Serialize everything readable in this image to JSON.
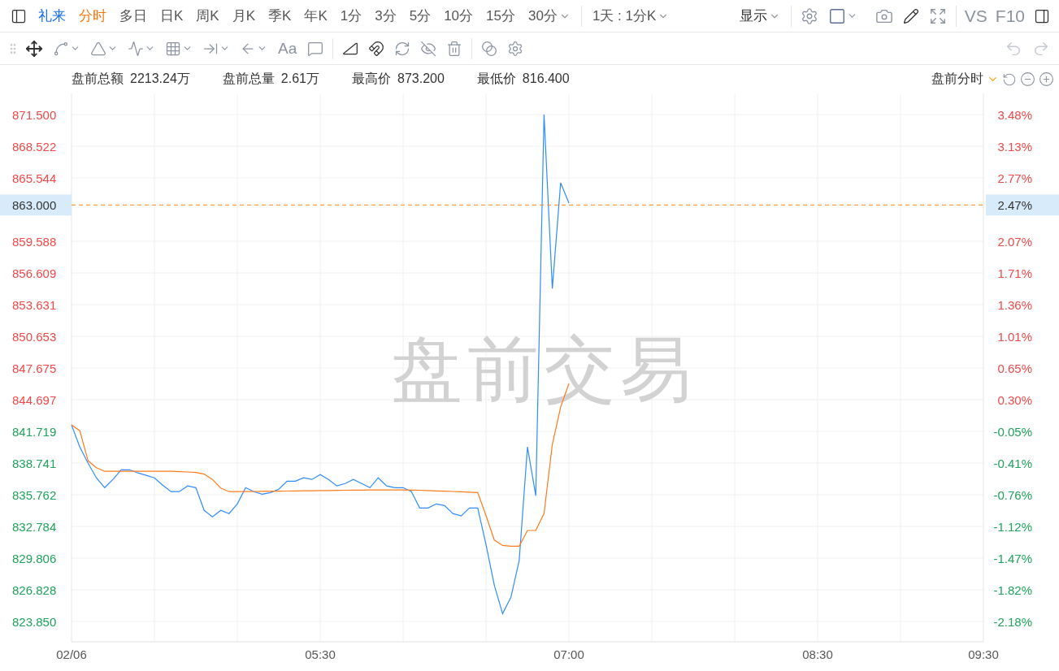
{
  "toolbar": {
    "symbol": "礼来",
    "periods": [
      {
        "label": "分时",
        "selected": true,
        "has_menu": false
      },
      {
        "label": "多日",
        "selected": false,
        "has_menu": false
      },
      {
        "label": "日K",
        "selected": false,
        "has_menu": false
      },
      {
        "label": "周K",
        "selected": false,
        "has_menu": false
      },
      {
        "label": "月K",
        "selected": false,
        "has_menu": false
      },
      {
        "label": "季K",
        "selected": false,
        "has_menu": false
      },
      {
        "label": "年K",
        "selected": false,
        "has_menu": false
      },
      {
        "label": "1分",
        "selected": false,
        "has_menu": false
      },
      {
        "label": "3分",
        "selected": false,
        "has_menu": false
      },
      {
        "label": "5分",
        "selected": false,
        "has_menu": false
      },
      {
        "label": "10分",
        "selected": false,
        "has_menu": false
      },
      {
        "label": "15分",
        "selected": false,
        "has_menu": false
      },
      {
        "label": "30分",
        "selected": false,
        "has_menu": true
      }
    ],
    "range": "1天 : 1分K",
    "display": "显示",
    "vs": "VS",
    "f10": "F10"
  },
  "drawing_toolbar": {
    "text_tool": "Aa"
  },
  "stats": [
    {
      "label": "盘前总额",
      "value": "2213.24万"
    },
    {
      "label": "盘前总量",
      "value": "2.61万"
    },
    {
      "label": "最高价",
      "value": "873.200"
    },
    {
      "label": "最低价",
      "value": "816.400"
    }
  ],
  "session_selector": "盘前分时",
  "chart": {
    "watermark": "盘前交易",
    "current_percent": "2.47%",
    "percent_axis": [
      {
        "label": "3.48%",
        "color": "#f04848"
      },
      {
        "label": "3.13%",
        "color": "#f04848"
      },
      {
        "label": "2.77%",
        "color": "#f04848"
      },
      {
        "label": "2.07%",
        "color": "#f04848"
      },
      {
        "label": "1.71%",
        "color": "#f04848"
      },
      {
        "label": "1.36%",
        "color": "#f04848"
      },
      {
        "label": "1.01%",
        "color": "#f04848"
      },
      {
        "label": "0.65%",
        "color": "#f04848"
      },
      {
        "label": "0.30%",
        "color": "#f04848"
      },
      {
        "label": "-0.05%",
        "color": "#1ea35b"
      },
      {
        "label": "-0.41%",
        "color": "#1ea35b"
      },
      {
        "label": "-0.76%",
        "color": "#1ea35b"
      },
      {
        "label": "-1.12%",
        "color": "#1ea35b"
      },
      {
        "label": "-1.47%",
        "color": "#1ea35b"
      },
      {
        "label": "-1.82%",
        "color": "#1ea35b"
      },
      {
        "label": "-2.18%",
        "color": "#1ea35b"
      }
    ],
    "chart_data": {
      "type": "line",
      "categories": [
        "02/06",
        null,
        null,
        null,
        null,
        null,
        null,
        null,
        null,
        null,
        null,
        null,
        null,
        null,
        null,
        null,
        null,
        null,
        null,
        null,
        null,
        null,
        null,
        null,
        null,
        null,
        null,
        null,
        null,
        null,
        "05:30",
        null,
        null,
        null,
        null,
        null,
        null,
        null,
        null,
        null,
        null,
        null,
        null,
        null,
        null,
        null,
        null,
        null,
        null,
        null,
        null,
        null,
        null,
        null,
        null,
        null,
        null,
        null,
        null,
        null,
        "07:00",
        null,
        null,
        null,
        null,
        null,
        null,
        null,
        null,
        null,
        null,
        null,
        null,
        null,
        null,
        null,
        null,
        null,
        null,
        null,
        null,
        null,
        null,
        null,
        null,
        null,
        null,
        null,
        null,
        null,
        "08:30",
        null,
        null,
        null,
        null,
        null,
        null,
        null,
        null,
        null,
        null,
        null,
        null,
        null,
        null,
        null,
        null,
        null,
        null,
        null,
        "09:30"
      ],
      "series": [
        {
          "color": "#2f8cff",
          "values": [
            842.32,
            840.25,
            838.72,
            837.35,
            836.43,
            837.2,
            838.11,
            838.11,
            837.81,
            837.58,
            837.35,
            836.66,
            836.05,
            836.05,
            836.59,
            836.43,
            834.29,
            833.68,
            834.29,
            833.99,
            834.9,
            836.43,
            836.05,
            835.82,
            835.97,
            836.28,
            837.04,
            837.04,
            837.35,
            837.2,
            837.65,
            837.2,
            836.59,
            836.81,
            837.2,
            836.81,
            836.43,
            837.35,
            836.59,
            836.43,
            836.43,
            836.05,
            834.52,
            834.52,
            834.9,
            834.75,
            833.99,
            833.76,
            834.52,
            834.52,
            831.08,
            827.26,
            824.59,
            826.12,
            829.56,
            840.25,
            835.67,
            871.5,
            855.15,
            865.08,
            863.17,
            null,
            null,
            null,
            null,
            null,
            null,
            null,
            null,
            null,
            null,
            null,
            null,
            null,
            null,
            null,
            null,
            null,
            null,
            null,
            null,
            null,
            null,
            null,
            null,
            null,
            null,
            null,
            null,
            null,
            null,
            null,
            null,
            null,
            null,
            null,
            null,
            null,
            null,
            null,
            null,
            null,
            null,
            null,
            null,
            null,
            null,
            null,
            null,
            null,
            null
          ]
        },
        {
          "color": "#ff7a1a",
          "values": [
            842.32,
            841.78,
            838.95,
            838.3,
            837.96,
            837.96,
            837.96,
            837.96,
            837.96,
            837.96,
            837.96,
            837.96,
            837.96,
            837.93,
            837.9,
            837.85,
            837.7,
            837.2,
            836.4,
            836.05,
            836.05,
            836.06,
            836.07,
            836.08,
            836.09,
            836.1,
            836.11,
            836.12,
            836.13,
            836.14,
            836.15,
            836.16,
            836.17,
            836.18,
            836.19,
            836.2,
            836.21,
            836.21,
            836.21,
            836.21,
            836.21,
            836.2,
            836.18,
            836.15,
            836.12,
            836.1,
            836.07,
            836.04,
            836.0,
            835.97,
            833.8,
            831.5,
            831.0,
            830.93,
            830.93,
            832.4,
            832.4,
            834.0,
            840.5,
            844.0,
            846.2,
            null,
            null,
            null,
            null,
            null,
            null,
            null,
            null,
            null,
            null,
            null,
            null,
            null,
            null,
            null,
            null,
            null,
            null,
            null,
            null,
            null,
            null,
            null,
            null,
            null,
            null,
            null,
            null,
            null,
            null,
            null,
            null,
            null,
            null,
            null,
            null,
            null,
            null,
            null,
            null,
            null,
            null,
            null,
            null,
            null,
            null,
            null,
            null,
            null,
            null
          ]
        }
      ],
      "ylim": [
        821.94,
        873.49
      ],
      "yticks": [
        {
          "value": 871.5,
          "label": "871.500"
        },
        {
          "value": 868.522,
          "label": "868.522"
        },
        {
          "value": 865.544,
          "label": "865.544"
        },
        {
          "value": 859.588,
          "label": "859.588"
        },
        {
          "value": 856.609,
          "label": "856.609"
        },
        {
          "value": 853.631,
          "label": "853.631"
        },
        {
          "value": 850.653,
          "label": "850.653"
        },
        {
          "value": 847.675,
          "label": "847.675"
        },
        {
          "value": 844.697,
          "label": "844.697"
        },
        {
          "value": 841.719,
          "label": "841.719"
        },
        {
          "value": 838.741,
          "label": "838.741"
        },
        {
          "value": 835.762,
          "label": "835.762"
        },
        {
          "value": 832.784,
          "label": "832.784"
        },
        {
          "value": 829.806,
          "label": "829.806"
        },
        {
          "value": 826.828,
          "label": "826.828"
        },
        {
          "value": 823.85,
          "label": "823.850"
        }
      ],
      "grid": true,
      "ref_lines": [
        {
          "axis": "y",
          "value": 863,
          "label": "863.000",
          "color": "#ff8a1a"
        }
      ]
    }
  }
}
